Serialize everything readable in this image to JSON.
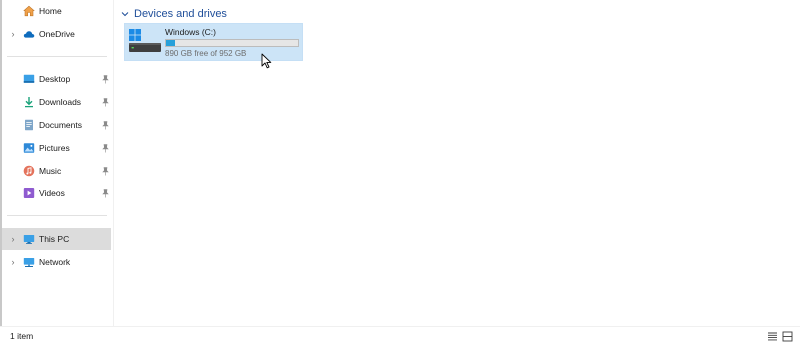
{
  "sidebar": {
    "items": [
      {
        "label": "Home"
      },
      {
        "label": "OneDrive"
      },
      {
        "label": "Desktop"
      },
      {
        "label": "Downloads"
      },
      {
        "label": "Documents"
      },
      {
        "label": "Pictures"
      },
      {
        "label": "Music"
      },
      {
        "label": "Videos"
      },
      {
        "label": "This PC"
      },
      {
        "label": "Network"
      }
    ]
  },
  "main": {
    "group_title": "Devices and drives",
    "drives": [
      {
        "name": "Windows (C:)",
        "free_text": "890 GB free of 952 GB",
        "used_fraction": 0.065
      }
    ]
  },
  "status": {
    "item_count": "1 item"
  },
  "colors": {
    "accent": "#26a0da",
    "selection": "#cce4f7",
    "group_header": "#1f4e99",
    "sidebar_selected": "#dcdcdc"
  },
  "icons": {
    "home": "home-icon",
    "onedrive": "cloud-icon",
    "desktop": "desktop-icon",
    "downloads": "download-arrow-icon",
    "documents": "document-icon",
    "pictures": "picture-icon",
    "music": "music-note-icon",
    "videos": "video-icon",
    "this_pc": "monitor-icon",
    "network": "network-icon",
    "pin": "pin-icon",
    "drive": "windows-drive-icon"
  }
}
